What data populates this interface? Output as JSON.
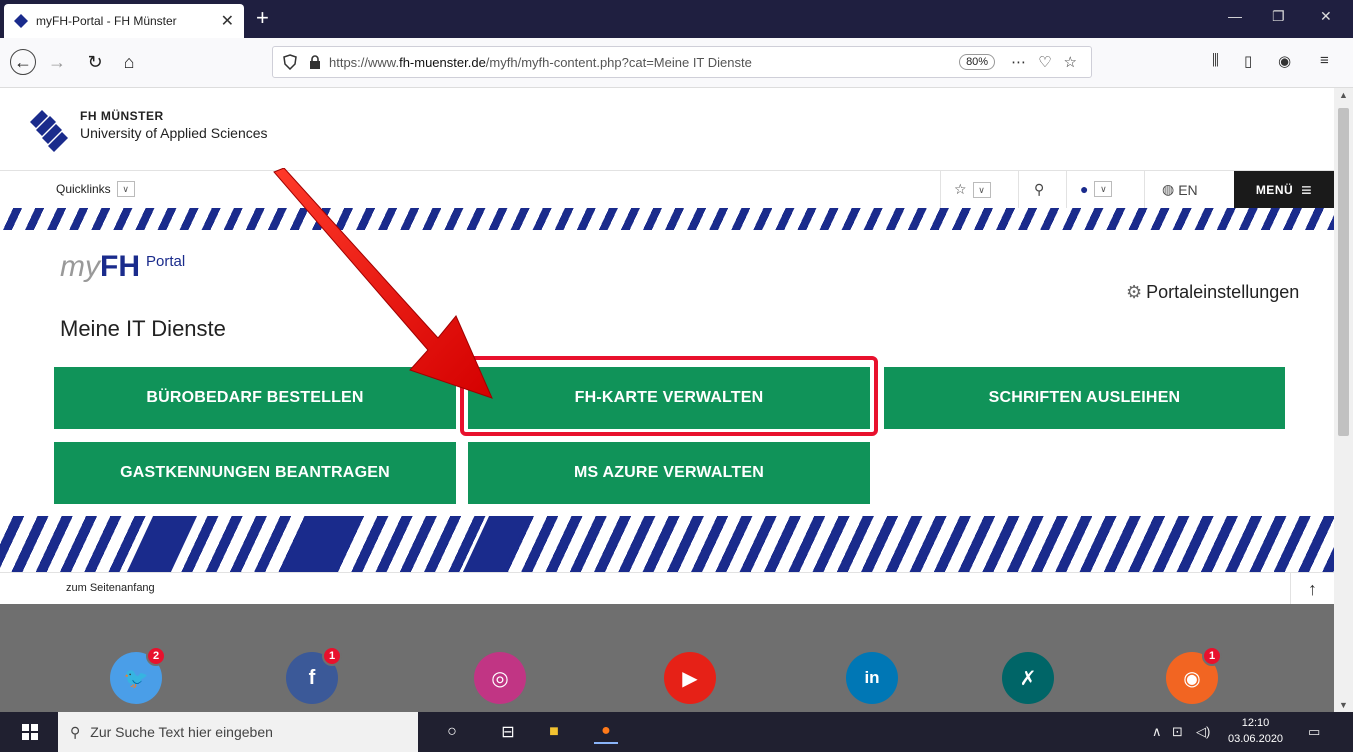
{
  "browser": {
    "tab_title": "myFH-Portal - FH Münster",
    "tab_close": "✕",
    "new_tab": "+",
    "url_prefix": "https://www.",
    "url_domain": "fh-muenster.de",
    "url_path": "/myfh/myfh-content.php?cat=Meine IT Dienste",
    "zoom": "80%"
  },
  "site": {
    "name": "FH MÜNSTER",
    "subtitle": "University of Applied Sciences",
    "quicklinks": "Quicklinks",
    "lang": "EN",
    "menu": "MENÜ"
  },
  "portal": {
    "my": "my",
    "fh": "FH",
    "portal": "Portal",
    "settings": "Portaleinstellungen",
    "page_title": "Meine IT Dienste"
  },
  "tiles": [
    {
      "label": "BÜROBEDARF BESTELLEN"
    },
    {
      "label": "FH-KARTE VERWALTEN"
    },
    {
      "label": "SCHRIFTEN AUSLEIHEN"
    },
    {
      "label": "GASTKENNUNGEN BEANTRAGEN"
    },
    {
      "label": "MS AZURE VERWALTEN"
    }
  ],
  "footer": {
    "to_top": "zum Seitenanfang",
    "social": [
      {
        "name": "twitter-icon",
        "glyph": "🐦",
        "badge": "2",
        "color": "#4a9ee8"
      },
      {
        "name": "facebook-icon",
        "glyph": "f",
        "badge": "1",
        "color": "#3b5998"
      },
      {
        "name": "instagram-icon",
        "glyph": "◎",
        "badge": "",
        "color": "#c13584"
      },
      {
        "name": "youtube-icon",
        "glyph": "▶",
        "badge": "",
        "color": "#e62117"
      },
      {
        "name": "linkedin-icon",
        "glyph": "in",
        "badge": "",
        "color": "#0077b5"
      },
      {
        "name": "xing-icon",
        "glyph": "✗",
        "badge": "",
        "color": "#006567"
      },
      {
        "name": "rss-icon",
        "glyph": "◉",
        "badge": "1",
        "color": "#f26522"
      }
    ]
  },
  "taskbar": {
    "search_placeholder": "Zur Suche Text hier eingeben",
    "time": "12:10",
    "date": "03.06.2020"
  },
  "colors": {
    "tile_green": "#109359",
    "brand_blue": "#1a2b8c",
    "highlight_red": "#e8112d"
  }
}
